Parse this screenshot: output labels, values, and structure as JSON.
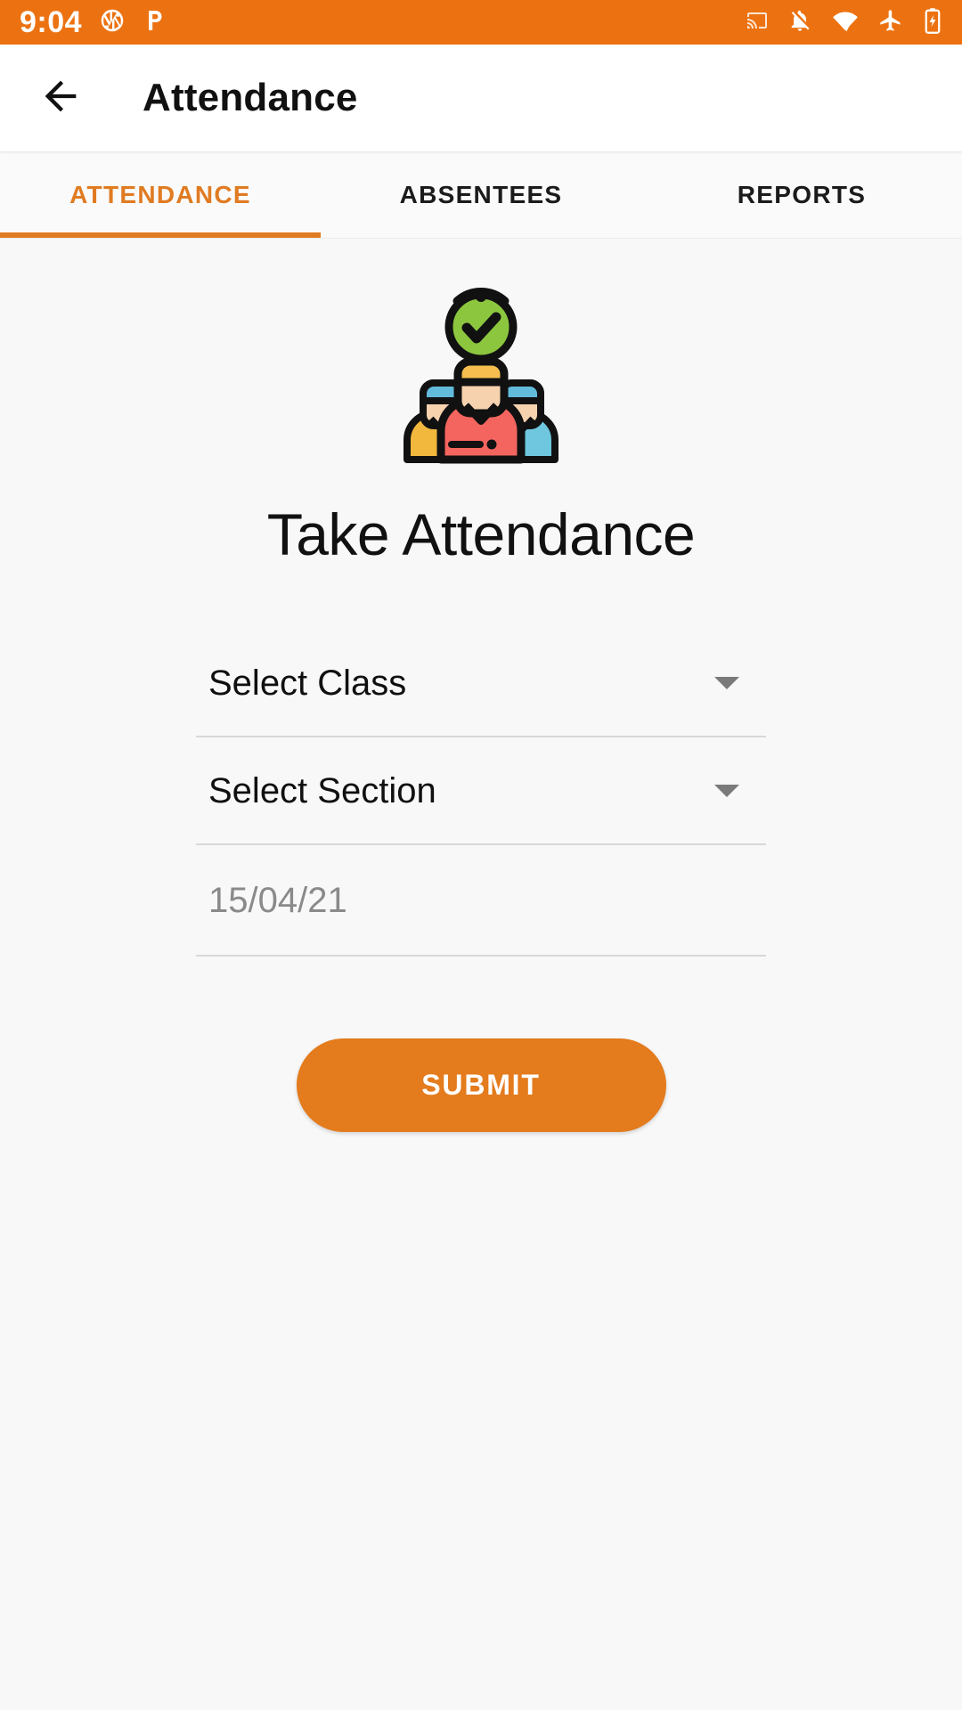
{
  "status_bar": {
    "time": "9:04",
    "left_icons": [
      "camera-aperture-icon",
      "parking-p-icon"
    ],
    "right_icons": [
      "cast-icon",
      "notifications-off-icon",
      "wifi-icon",
      "airplane-mode-icon",
      "battery-charging-icon"
    ],
    "background_color": "#EC7211",
    "foreground_color": "#FFFFFF"
  },
  "app_bar": {
    "back_icon": "arrow-back-icon",
    "title": "Attendance"
  },
  "tabs": {
    "active_index": 0,
    "accent_color": "#E07B22",
    "items": [
      {
        "label": "ATTENDANCE"
      },
      {
        "label": "ABSENTEES"
      },
      {
        "label": "REPORTS"
      }
    ]
  },
  "main": {
    "illustration": "group-of-people-with-green-check-icon",
    "heading": "Take Attendance",
    "fields": [
      {
        "name": "class",
        "value": "Select Class",
        "is_placeholder": false,
        "caret": "dropdown-caret-icon"
      },
      {
        "name": "section",
        "value": "Select Section",
        "is_placeholder": false,
        "caret": "dropdown-caret-icon"
      },
      {
        "name": "date",
        "value": "15/04/21",
        "is_placeholder": true,
        "caret": null
      }
    ],
    "submit_label": "SUBMIT",
    "submit_color": "#E47B1C"
  }
}
